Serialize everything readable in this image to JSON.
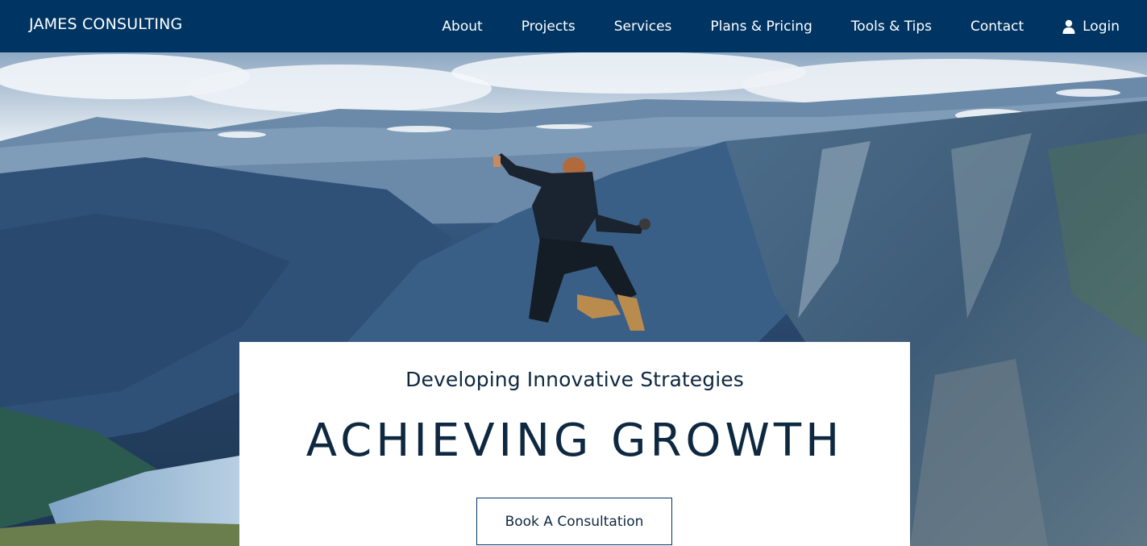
{
  "navbar": {
    "brand": "JAMES CONSULTING",
    "links": [
      {
        "label": "About"
      },
      {
        "label": "Projects"
      },
      {
        "label": "Services"
      },
      {
        "label": "Plans & Pricing"
      },
      {
        "label": "Tools & Tips"
      },
      {
        "label": "Contact"
      }
    ],
    "login": {
      "label": "Login",
      "icon": "user-icon"
    },
    "background_color": "#003563"
  },
  "hero": {
    "image_subject": "person-jumping-over-mountain-fjord",
    "subtitle": "Developing Innovative Strategies",
    "headline": "ACHIEVING GROWTH",
    "cta_label": "Book A Consultation",
    "text_color": "#0e2840",
    "card_background": "#ffffff"
  }
}
